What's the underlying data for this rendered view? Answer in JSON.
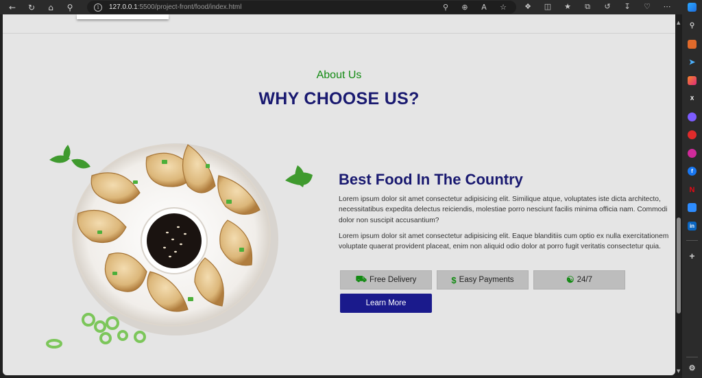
{
  "browser": {
    "url_host": "127.0.0.1",
    "url_path": ":5500/project-front/food/index.html"
  },
  "section": {
    "eyebrow": "About Us",
    "heading": "WHY CHOOSE US?",
    "title": "Best Food In The Country",
    "paragraph1": "Lorem ipsum dolor sit amet consectetur adipisicing elit. Similique atque, voluptates iste dicta architecto, necessitatibus expedita delectus reiciendis, molestiae porro nesciunt facilis minima officia nam. Commodi dolor non suscipit accusantium?",
    "paragraph2": "Lorem ipsum dolor sit amet consectetur adipisicing elit. Eaque blanditiis cum optio ex nulla exercitationem voluptate quaerat provident placeat, enim non aliquid odio dolor at porro fugit veritatis consectetur quia."
  },
  "features": [
    {
      "label": "Free Delivery",
      "icon": "truck-icon"
    },
    {
      "label": "Easy Payments",
      "icon": "dollar-icon"
    },
    {
      "label": "24/7",
      "icon": "headset-icon"
    }
  ],
  "cta": {
    "label": "Learn More"
  },
  "colors": {
    "accent_green": "#138a13",
    "navy": "#191970",
    "button_navy": "#1a1a8c",
    "feature_bg": "#bdbdbd",
    "page_bg": "#e5e5e5"
  }
}
